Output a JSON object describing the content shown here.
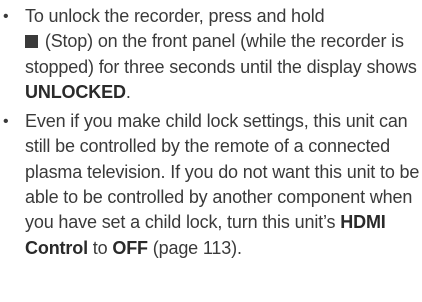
{
  "notes": [
    {
      "bullet": "•",
      "segments": {
        "s1": "To unlock the recorder, press and hold",
        "s2": " (Stop) on the front panel (while the recorder is stopped) for three seconds until the display shows ",
        "s3": "UNLOCKED",
        "s4": "."
      }
    },
    {
      "bullet": "•",
      "segments": {
        "s1": "Even if you make child lock settings, this unit can still be controlled by the remote of a connected plasma television. If you do not want this unit to be able to be controlled by another component when you have set a child lock, turn this unit’s ",
        "s2": "HDMI Control",
        "s3": " to ",
        "s4": "OFF",
        "s5": " (page 113)."
      }
    }
  ],
  "icons": {
    "stop": "stop-icon"
  }
}
